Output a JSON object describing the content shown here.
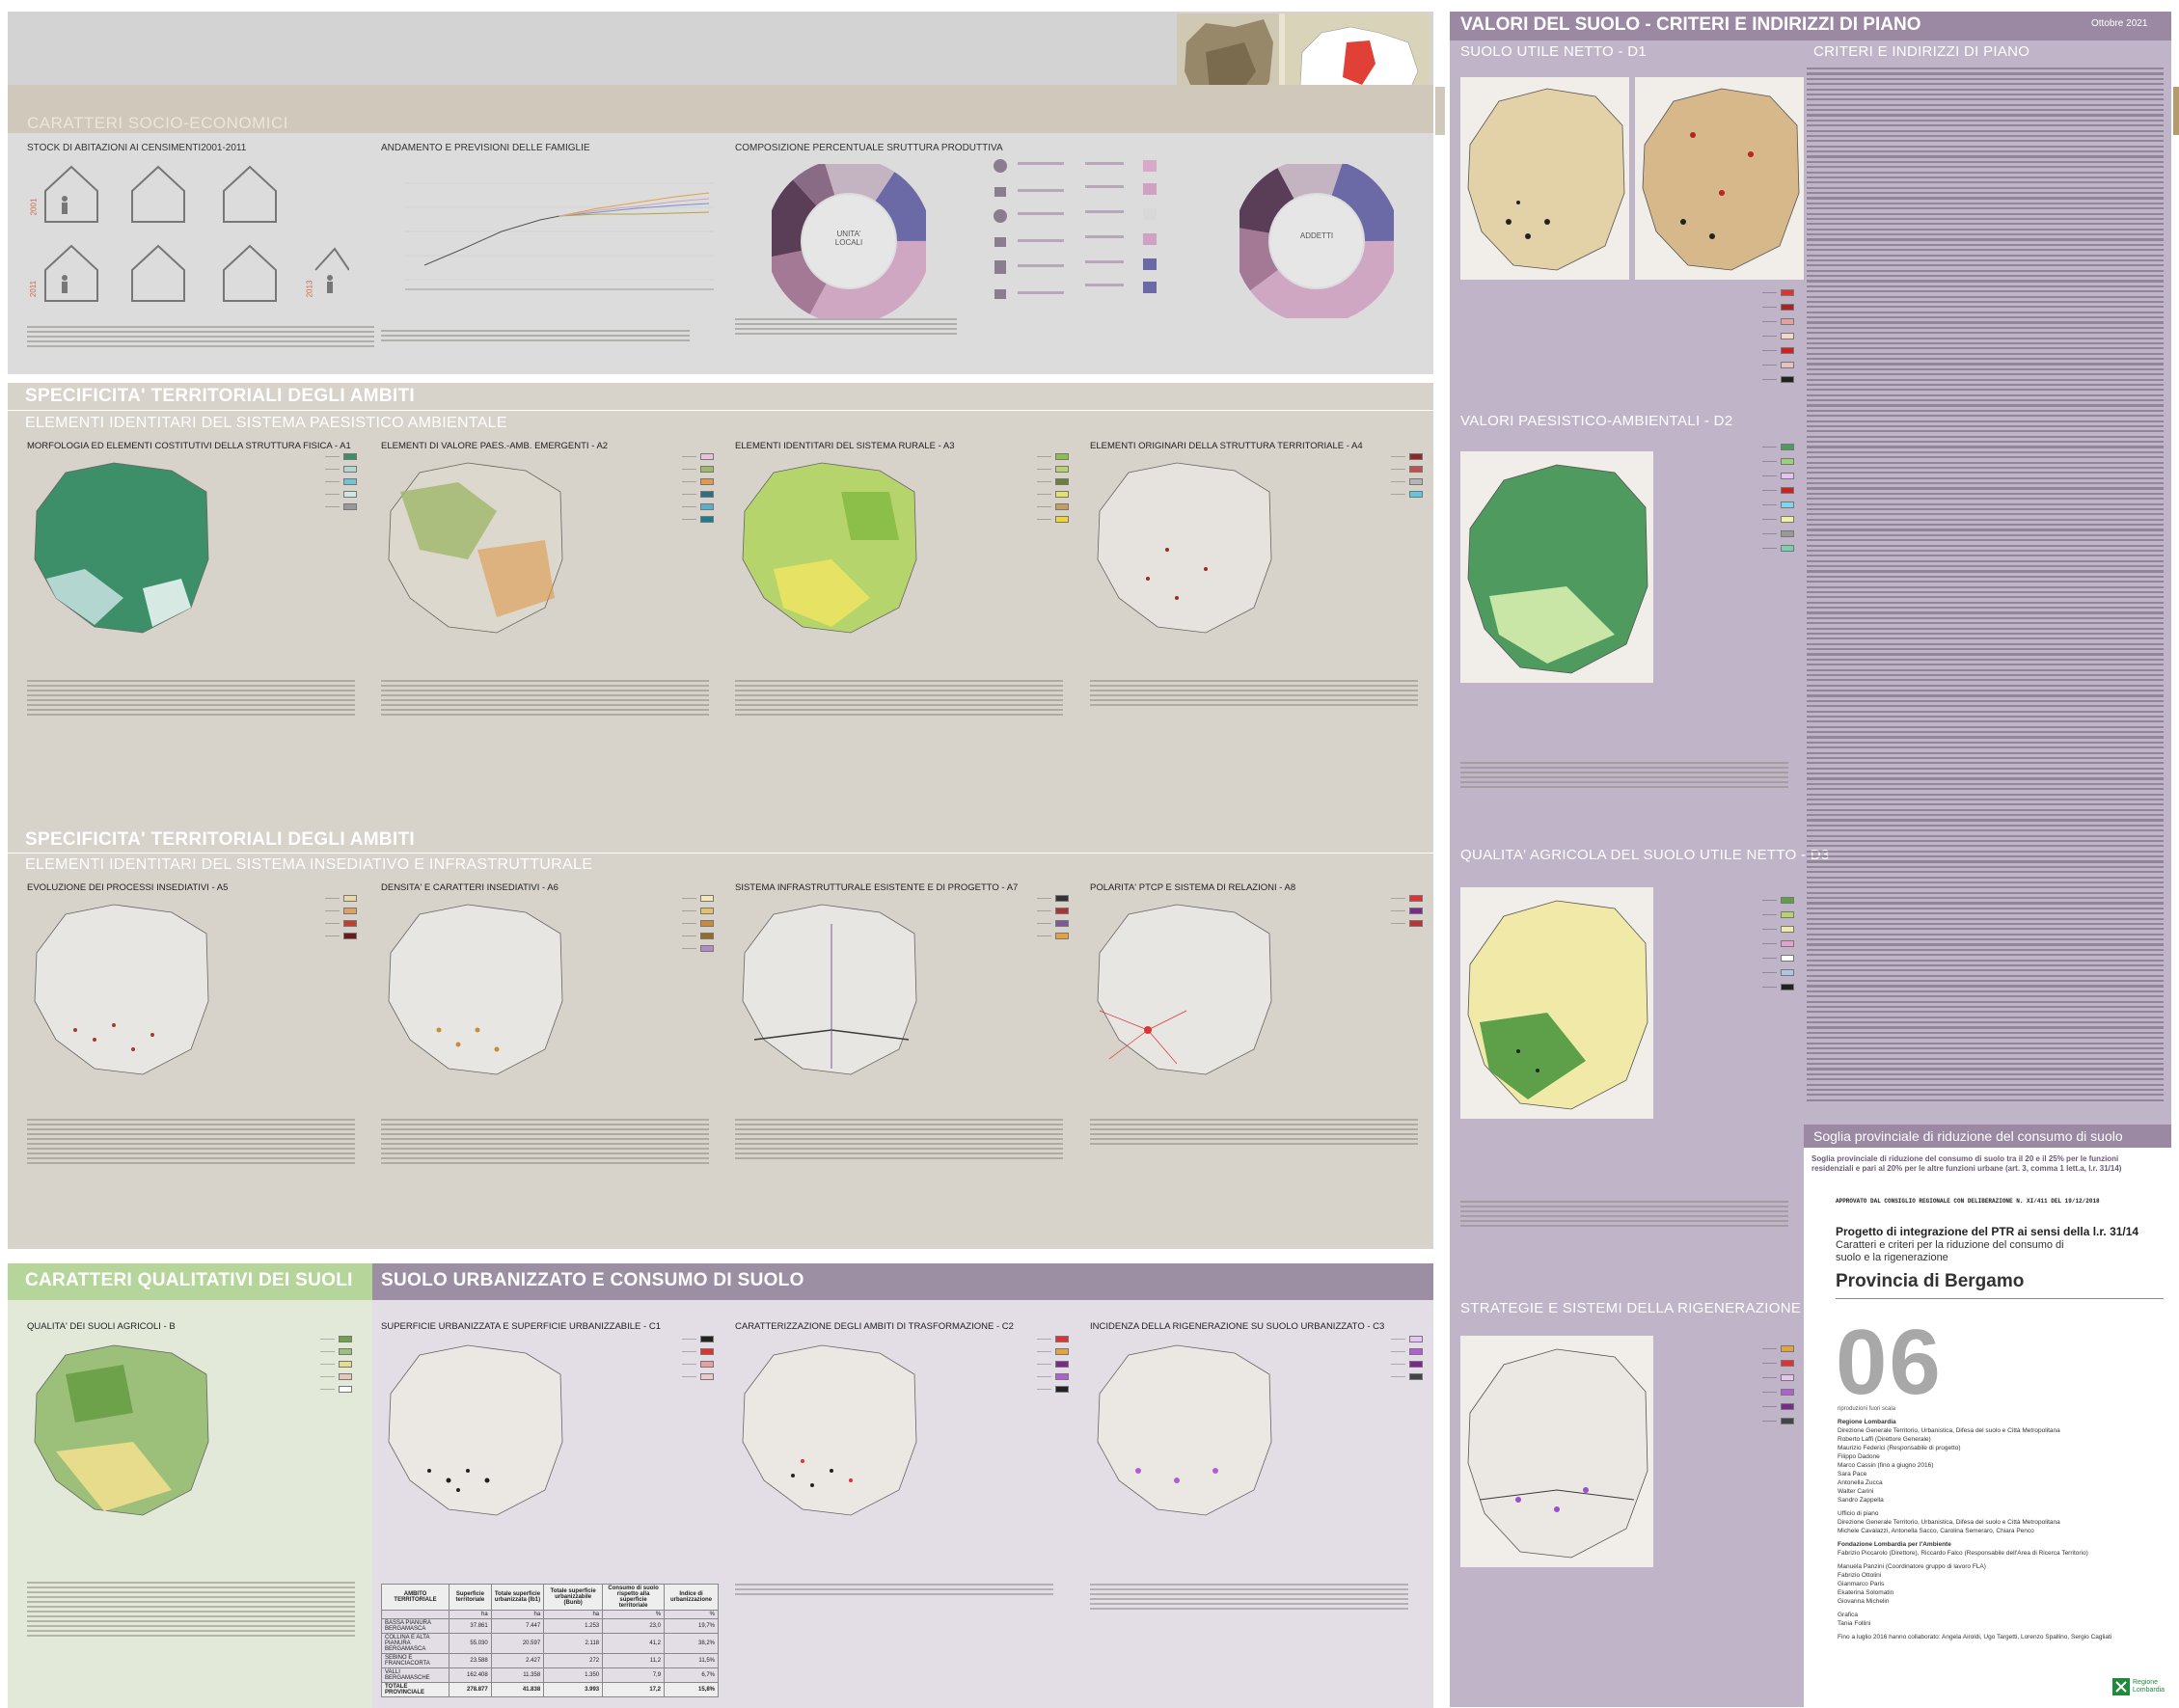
{
  "left": {
    "socio_title": "CARATTERI SOCIO-ECONOMICI",
    "stock_title": "STOCK DI ABITAZIONI AI CENSIMENTI2001-2011",
    "year_2001": "2001",
    "year_2011": "2011",
    "year_2013": "2013",
    "famiglie_title": "ANDAMENTO E PREVISIONI DELLE FAMIGLIE",
    "composizione_title": "COMPOSIZIONE PERCENTUALE SRUTTURA PRODUTTIVA",
    "donut1_label": "UNITA' LOCALI",
    "donut2_label": "ADDETTI",
    "ambiti_title_1": "SPECIFICITA' TERRITORIALI DEGLI AMBITI",
    "ambiti_sub_1": "ELEMENTI IDENTITARI DEL SISTEMA PAESISTICO AMBIENTALE",
    "maps_row1": [
      "MORFOLOGIA ED ELEMENTI COSTITUTIVI DELLA STRUTTURA FISICA - A1",
      "ELEMENTI DI VALORE PAES.-AMB. EMERGENTI - A2",
      "ELEMENTI IDENTITARI DEL SISTEMA RURALE - A3",
      "ELEMENTI ORIGINARI DELLA STRUTTURA TERRITORIALE - A4"
    ],
    "ambiti_title_2": "SPECIFICITA' TERRITORIALI DEGLI AMBITI",
    "ambiti_sub_2": "ELEMENTI IDENTITARI  DEL SISTEMA INSEDIATIVO E INFRASTRUTTURALE",
    "maps_row2": [
      "EVOLUZIONE DEI PROCESSI INSEDIATIVI - A5",
      "DENSITA' E CARATTERI INSEDIATIVI - A6",
      "SISTEMA INFRASTRUTTURALE ESISTENTE E  DI PROGETTO - A7",
      "POLARITA' PTCP E SISTEMA DI RELAZIONI - A8"
    ],
    "qual_title": "CARATTERI QUALITATIVI DEI SUOLI",
    "qual_map": "QUALITA' DEI SUOLI AGRICOLI - B",
    "urb_title": "SUOLO URBANIZZATO E CONSUMO DI SUOLO",
    "maps_row3": [
      "SUPERFICIE URBANIZZATA E SUPERFICIE URBANIZZABILE - C1",
      "CARATTERIZZAZIONE DEGLI AMBITI DI TRASFORMAZIONE - C2",
      "INCIDENZA DELLA RIGENERAZIONE SU SUOLO URBANIZZATO - C3"
    ],
    "table": {
      "headers": [
        "AMBITO TERRITORIALE",
        "Superficie territoriale",
        "Totale superficie urbanizzata (Ib1)",
        "Totale superficie urbanizzabile (Bunb)",
        "Consumo di suolo rispetto alla superficie territoriale",
        "Indice di urbanizzazione"
      ],
      "units": [
        "",
        "ha",
        "ha",
        "ha",
        "%",
        "%"
      ],
      "rows": [
        [
          "BASSA PIANURA BERGAMASCA",
          "37.861",
          "7.447",
          "1.253",
          "23,0",
          "19,7%"
        ],
        [
          "COLLINA E ALTA PIANURA BERGAMASCA",
          "55.030",
          "20.597",
          "2.118",
          "41,2",
          "38,2%"
        ],
        [
          "SEBINO E FRANCIACORTA",
          "23.588",
          "2.427",
          "272",
          "11,2",
          "11,5%"
        ],
        [
          "VALLI BERGAMASCHE",
          "162.408",
          "11.358",
          "1.350",
          "7,9",
          "6,7%"
        ],
        [
          "TOTALE PROVINCIALE",
          "278.877",
          "41.838",
          "3.993",
          "17,2",
          "15,8%"
        ]
      ]
    }
  },
  "right": {
    "title": "VALORI DEL SUOLO - CRITERI E INDIRIZZI DI PIANO",
    "date": "Ottobre 2021",
    "d1": "SUOLO UTILE NETTO - D1",
    "criteri": "CRITERI E INDIRIZZI DI PIANO",
    "d2": "VALORI PAESISTICO-AMBIENTALI - D2",
    "d3": "QUALITA' AGRICOLA DEL SUOLO UTILE NETTO - D3",
    "d4": "STRATEGIE E SISTEMI DELLA RIGENERAZIONE - D4",
    "soglia_title": "Soglia provinciale di riduzione del consumo di suolo",
    "soglia_sub": "Soglia provinciale di riduzione del consumo di suolo tra il 20 e il 25% per le funzioni residenziali e pari al 20% per le altre funzioni urbane (art. 3, comma 1 lett.a, l.r. 31/14)",
    "approvato": "APPROVATO DAL CONSIGLIO REGIONALE CON DELIBERAZIONE   N. XI/411 DEL 19/12/2018",
    "progetto": "Progetto di integrazione del PTR ai sensi della l.r. 31/14",
    "caratteri": "Caratteri e criteri per la riduzione del consumo di suolo e la rigenerazione",
    "provincia": "Provincia di Bergamo",
    "number": "06",
    "riproduzioni": "riproduzioni fuori scala",
    "credits": [
      "Regione Lombardia",
      "Direzione Generale Territorio, Urbanistica, Difesa del suolo e Città Metropolitana",
      "Roberto Laffi (Direttore Generale)",
      "Maurizio Federici (Responsabile di progetto)",
      "Filippo Dadone",
      "Marco Cassin (fino a giugno 2016)",
      "Sara Pace",
      "Antonella Zucca",
      "Walter Carini",
      "Sandro Zappella",
      "",
      "Ufficio di piano",
      "Direzione Generale Territorio, Urbanistica, Difesa del suolo e Città Metropolitana",
      "Michele Cavalazzi, Antonella Sacco, Carolina Semeraro, Chiara Penco",
      "",
      "Fondazione Lombardia per l'Ambiente",
      "Fabrizio Piccarolo (Direttore), Riccardo Falco (Responsabile dell'Area di Ricerca Territorio)",
      "",
      "Manuela Panzini (Coordinatore gruppo di lavoro FLA)",
      "Fabrizio Ottolini",
      "Gianmarco Paris",
      "Ekaterina Solomatin",
      "Giovanna Michelin",
      "",
      "Grafica",
      "Tania Follini",
      "",
      "Fino a luglio 2016 hanno collaborato: Angela Airoldi, Ugo Targetti, Lorenzo Spallino, Sergio Cagliati"
    ],
    "logo": "Regione Lombardia"
  },
  "colors": {
    "socio_band": "#cfc8bb",
    "ambiti_band": "#d7d2ca",
    "qual_head": "#b6d59a",
    "urb_head": "#9d8fa3",
    "right_bg": "#c0b4c8",
    "right_head": "#9b89a4"
  }
}
